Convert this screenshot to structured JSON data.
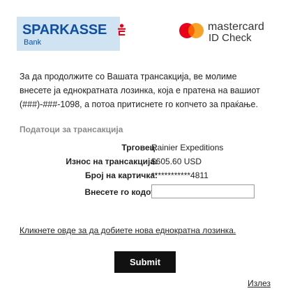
{
  "bank_logo": {
    "name": "SPARKASSE",
    "sub": "Bank",
    "accent_color": "#0e4fa0",
    "mark_color": "#e2001a",
    "background": "#cfe3f3"
  },
  "card_logo": {
    "line1": "mastercard",
    "line2": "ID Check",
    "circle_left_color": "#eb001b",
    "circle_right_color": "#f79e1b"
  },
  "instructions": "За да продолжите со Вашата трансакција, ве молиме внесете ја еднократната лозинка, која е пратена на вашиот (###)-###-1098, а потоа притиснете го копчето за праќање.",
  "section_title": "Податоци за трансакција",
  "details": [
    {
      "label": "Трговец:",
      "value": "Rainier Expeditions"
    },
    {
      "label": "Износ на трансакција:",
      "value": "$605.60 USD"
    },
    {
      "label": "Број на картичка:",
      "value": "************4811"
    },
    {
      "label": "Внесете го кодот:",
      "value": ""
    }
  ],
  "resend_link": "Кликнете овде за да добиете нова еднократна лозинка.",
  "submit_label": "Submit",
  "exit_link": "Излез"
}
